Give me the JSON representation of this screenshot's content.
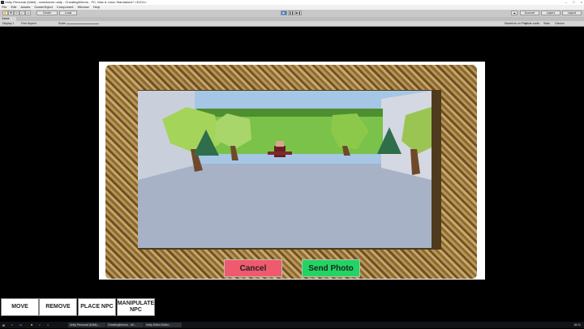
{
  "window": {
    "title": "Unity Personal (64bit) - mainscene.unity - CheatingMirrors - PC, Mac & Linux Standalone* <DX11>",
    "controls": [
      "–",
      "□",
      "×"
    ]
  },
  "menu": [
    "File",
    "Edit",
    "Assets",
    "GameObject",
    "Component",
    "Window",
    "Help"
  ],
  "toolbar": {
    "pivot_label": "Center",
    "space_label": "Local",
    "account_label": "Account",
    "layers_label": "Layers",
    "layout_label": "Layout"
  },
  "tab": {
    "label": "Game"
  },
  "game_bar": {
    "display": "Display 1",
    "aspect": "Free Aspect",
    "scale_label": "Scale",
    "options": [
      "Maximize on Play",
      "Mute audio",
      "Stats",
      "Gizmos"
    ]
  },
  "dialog": {
    "cancel_label": "Cancel",
    "send_label": "Send Photo"
  },
  "actions": [
    {
      "label": "MOVE"
    },
    {
      "label": "REMOVE"
    },
    {
      "label": "PLACE NPC"
    },
    {
      "label": "MANIPULATE NPC"
    }
  ],
  "taskbar": {
    "apps": [
      "Unity Personal (64bit)...",
      "CheatingMirrors - Mi...",
      "Unity Editor.Editor..."
    ],
    "clock": "18:21"
  },
  "colors": {
    "cancel": "#ef5a6e",
    "send": "#22d463",
    "sky": "#a6c6e6",
    "floor": "#a7b2c6"
  }
}
